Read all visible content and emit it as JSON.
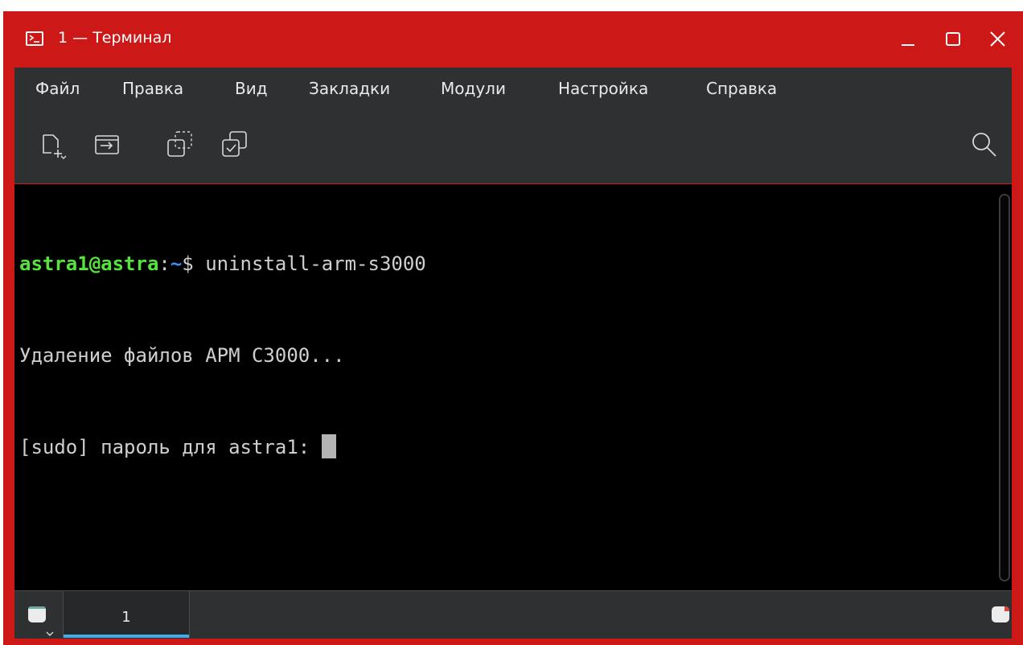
{
  "window": {
    "title": "1 — Терминал",
    "accent_color": "#cd1818",
    "controls": {
      "minimize_icon": "minimize-icon",
      "maximize_icon": "maximize-icon",
      "close_icon": "close-icon"
    }
  },
  "menu": {
    "items": [
      "Файл",
      "Правка",
      "Вид",
      "Закладки",
      "Модули",
      "Настройка",
      "Справка"
    ]
  },
  "toolbar": {
    "icons": [
      "new-tab-icon",
      "split-view-icon",
      "detach-tab-icon",
      "copy-input-icon",
      "search-icon"
    ]
  },
  "terminal": {
    "prompt_user": "astra1@astra",
    "prompt_sep": ":",
    "prompt_path": "~",
    "prompt_symbol": "$ ",
    "command": "uninstall-arm-s3000",
    "output_line1": "Удаление файлов АРМ С3000...",
    "output_line2": "[sudo] пароль для astra1: "
  },
  "tabs": {
    "items": [
      {
        "label": "1",
        "active": true
      }
    ],
    "active_color": "#3daee9"
  }
}
